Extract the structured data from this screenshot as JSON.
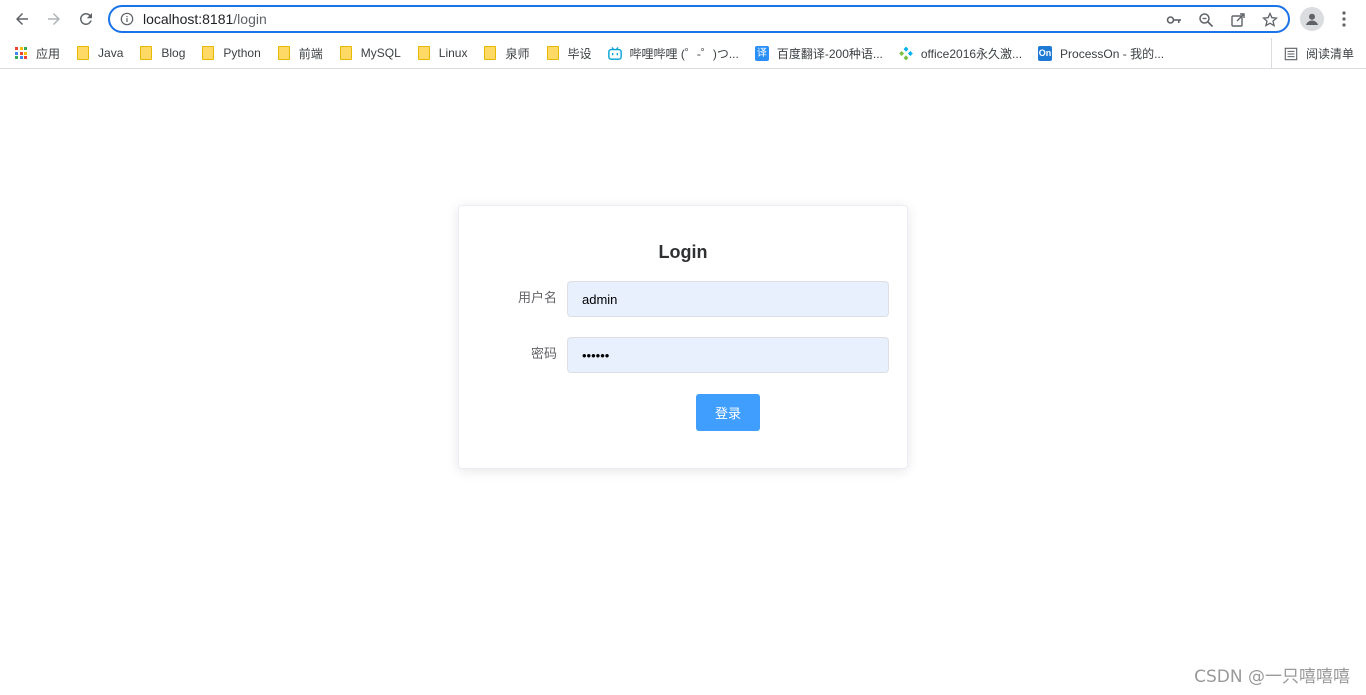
{
  "browser": {
    "url_host": "localhost:8181",
    "url_path": "/login",
    "bookmarks": [
      {
        "label": "应用",
        "icon": "apps-grid-icon"
      },
      {
        "label": "Java",
        "icon": "folder-icon"
      },
      {
        "label": "Blog",
        "icon": "folder-icon"
      },
      {
        "label": "Python",
        "icon": "folder-icon"
      },
      {
        "label": "前端",
        "icon": "folder-icon"
      },
      {
        "label": "MySQL",
        "icon": "folder-icon"
      },
      {
        "label": "Linux",
        "icon": "folder-icon"
      },
      {
        "label": "泉师",
        "icon": "folder-icon"
      },
      {
        "label": "毕设",
        "icon": "folder-icon"
      },
      {
        "label": "哔哩哔哩 (゜-゜)つ...",
        "icon": "bilibili-icon"
      },
      {
        "label": "百度翻译-200种语...",
        "icon": "baidu-translate-icon"
      },
      {
        "label": "office2016永久激...",
        "icon": "diamond-icon"
      },
      {
        "label": "ProcessOn - 我的...",
        "icon": "processon-icon"
      }
    ],
    "reading_list": "阅读清单"
  },
  "login": {
    "title": "Login",
    "username_label": "用户名",
    "username_value": "admin",
    "password_label": "密码",
    "password_value": "••••••",
    "submit_label": "登录"
  },
  "watermark": "CSDN @一只嘻嘻嘻",
  "colors": {
    "accent": "#1a73e8",
    "button": "#409eff",
    "autofill": "#e8f0fe"
  }
}
